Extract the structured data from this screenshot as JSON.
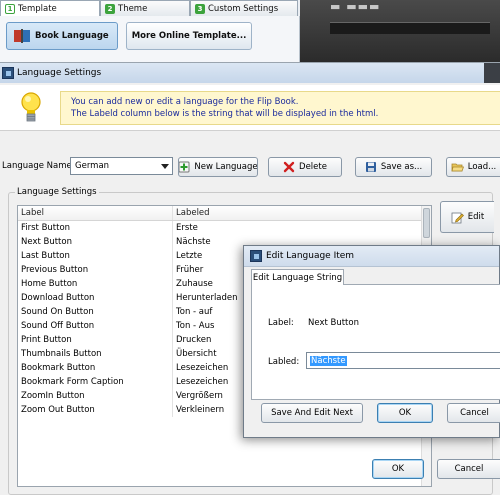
{
  "background_app": {
    "tabs": [
      {
        "number": "1",
        "label": "Template"
      },
      {
        "number": "2",
        "label": "Theme"
      },
      {
        "number": "3",
        "label": "Custom Settings"
      }
    ],
    "toolbar": {
      "book_language_label": "Book Language",
      "more_templates_label": "More Online Template..."
    }
  },
  "window": {
    "title": "Language Settings",
    "info_lines": [
      "You can add new or edit  a language for the Flip Book.",
      "The Labeld column below is the string that will be displayed in the html."
    ],
    "language_name_label": "Language Name:",
    "language_selected": "German",
    "buttons": {
      "new_language": "New Language",
      "delete": "Delete",
      "save_as": "Save as...",
      "load": "Load..."
    },
    "group_title": "Language Settings",
    "grid": {
      "columns": [
        "Label",
        "Labeled"
      ],
      "rows": [
        [
          "First Button",
          "Erste"
        ],
        [
          "Next Button",
          "Nächste"
        ],
        [
          "Last Button",
          "Letzte"
        ],
        [
          "Previous Button",
          "Früher"
        ],
        [
          "Home Button",
          "Zuhause"
        ],
        [
          "Download Button",
          "Herunterladen"
        ],
        [
          "Sound On Button",
          "Ton - auf"
        ],
        [
          "Sound Off Button",
          "Ton - Aus"
        ],
        [
          "Print Button",
          "Drucken"
        ],
        [
          "Thumbnails Button",
          "Übersicht"
        ],
        [
          "Bookmark Button",
          "Lesezeichen"
        ],
        [
          "Bookmark Form Caption",
          "Lesezeichen"
        ],
        [
          "ZoomIn Button",
          "Vergrößern"
        ],
        [
          "Zoom Out Button",
          "Verkleinern"
        ]
      ]
    },
    "edit_button": "Edit",
    "ok_button": "OK",
    "cancel_button": "Cancel"
  },
  "dialog": {
    "title": "Edit Language Item",
    "tab_label": "Edit Language String",
    "label_caption": "Label:",
    "label_value": "Next Button",
    "labeled_caption": "Labled:",
    "labeled_value": "Nächste",
    "save_edit_button": "Save And Edit Next",
    "ok_button": "OK",
    "cancel_button": "Cancel"
  },
  "colors": {
    "info_text": "#1a2a9c",
    "info_background": "#fff7cf",
    "selection": "#3399ff",
    "tab_number": "#3da33d"
  }
}
